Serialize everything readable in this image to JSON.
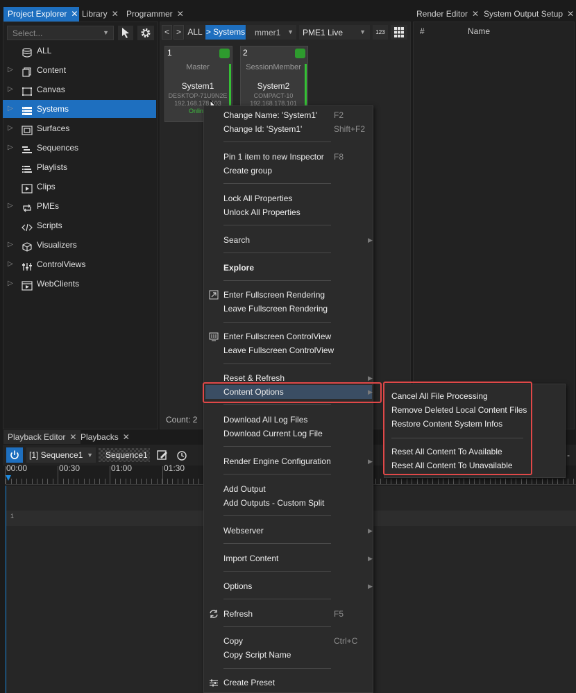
{
  "tabs_top_left": [
    {
      "label": "Project Explorer",
      "close": "✕"
    },
    {
      "label": "Library",
      "close": "✕"
    },
    {
      "label": "Programmer",
      "close": "✕"
    }
  ],
  "tabs_top_right": [
    {
      "label": "Render Editor",
      "close": "✕"
    },
    {
      "label": "System Output Setup",
      "close": "✕"
    }
  ],
  "explorer": {
    "select_placeholder": "Select...",
    "items": [
      {
        "label": "ALL",
        "icon": "database-icon",
        "expandable": false
      },
      {
        "label": "Content",
        "icon": "content-icon",
        "expandable": true
      },
      {
        "label": "Canvas",
        "icon": "canvas-icon",
        "expandable": true
      },
      {
        "label": "Systems",
        "icon": "systems-icon",
        "expandable": true,
        "selected": true
      },
      {
        "label": "Surfaces",
        "icon": "surfaces-icon",
        "expandable": true
      },
      {
        "label": "Sequences",
        "icon": "sequences-icon",
        "expandable": true
      },
      {
        "label": "Playlists",
        "icon": "playlists-icon",
        "expandable": false
      },
      {
        "label": "Clips",
        "icon": "clips-icon",
        "expandable": false
      },
      {
        "label": "PMEs",
        "icon": "pmes-icon",
        "expandable": true
      },
      {
        "label": "Scripts",
        "icon": "scripts-icon",
        "expandable": false
      },
      {
        "label": "Visualizers",
        "icon": "visualizers-icon",
        "expandable": true
      },
      {
        "label": "ControlViews",
        "icon": "controlviews-icon",
        "expandable": true
      },
      {
        "label": "WebClients",
        "icon": "webclients-icon",
        "expandable": true
      }
    ]
  },
  "programmer": {
    "nav_back": "<",
    "nav_fwd": ">",
    "crumb_all": "ALL",
    "crumb_systems": "> Systems",
    "filter_value": "mmer1",
    "pme_value": "PME1 Live",
    "numeric_toggle": "123",
    "count": "Count: 2",
    "cards": [
      {
        "num": "1",
        "role": "Master",
        "name": "System1",
        "host": "DESKTOP-71U9N2E",
        "ip": "192.168.178.103",
        "status": "Online"
      },
      {
        "num": "2",
        "role": "SessionMember",
        "name": "System2",
        "host": "COMPACT-10",
        "ip": "192.168.178.101",
        "status": ""
      }
    ]
  },
  "output_table": {
    "col_hash": "#",
    "col_name": "Name"
  },
  "tabs_bottom": [
    {
      "label": "Playback Editor",
      "close": "✕"
    },
    {
      "label": "Playbacks",
      "close": "✕"
    }
  ],
  "playback": {
    "sequence_select": "[1] Sequence1",
    "sequence_name": "Sequence1",
    "ticks": [
      "00:00",
      "00:30",
      "01:00",
      "01:30"
    ],
    "track_number": "1"
  },
  "context_menu": {
    "items": [
      {
        "label": "Change Name: 'System1'",
        "shortcut": "F2"
      },
      {
        "label": "Change Id: 'System1'",
        "shortcut": "Shift+F2"
      },
      {
        "label": "Pin 1 item to new Inspector",
        "shortcut": "F8"
      },
      {
        "label": "Create group",
        "shortcut": ""
      },
      {
        "label": "Lock All Properties",
        "shortcut": ""
      },
      {
        "label": "Unlock All Properties",
        "shortcut": ""
      },
      {
        "label": "Search",
        "shortcut": ""
      },
      {
        "label": "Explore",
        "shortcut": ""
      },
      {
        "label": "Enter Fullscreen Rendering",
        "shortcut": ""
      },
      {
        "label": "Leave Fullscreen Rendering",
        "shortcut": ""
      },
      {
        "label": "Enter Fullscreen ControlView",
        "shortcut": ""
      },
      {
        "label": "Leave Fullscreen ControlView",
        "shortcut": ""
      },
      {
        "label": "Reset & Refresh",
        "shortcut": ""
      },
      {
        "label": "Content Options",
        "shortcut": ""
      },
      {
        "label": "Download All Log Files",
        "shortcut": ""
      },
      {
        "label": "Download Current Log File",
        "shortcut": ""
      },
      {
        "label": "Render Engine Configuration",
        "shortcut": ""
      },
      {
        "label": "Add Output",
        "shortcut": ""
      },
      {
        "label": "Add Outputs - Custom Split",
        "shortcut": ""
      },
      {
        "label": "Webserver",
        "shortcut": ""
      },
      {
        "label": "Import Content",
        "shortcut": ""
      },
      {
        "label": "Options",
        "shortcut": ""
      },
      {
        "label": "Refresh",
        "shortcut": "F5"
      },
      {
        "label": "Copy",
        "shortcut": "Ctrl+C"
      },
      {
        "label": "Copy Script Name",
        "shortcut": ""
      },
      {
        "label": "Create Preset",
        "shortcut": ""
      }
    ]
  },
  "submenu": {
    "items": [
      {
        "label": "Cancel All File Processing"
      },
      {
        "label": "Remove Deleted Local Content Files"
      },
      {
        "label": "Restore Content System Infos"
      },
      {
        "label": "Reset All Content To Available"
      },
      {
        "label": "Reset All Content To Unavailable"
      }
    ]
  },
  "colors": {
    "accent": "#1e6fbf",
    "online": "#35c035",
    "highlight_box": "#e04848"
  }
}
